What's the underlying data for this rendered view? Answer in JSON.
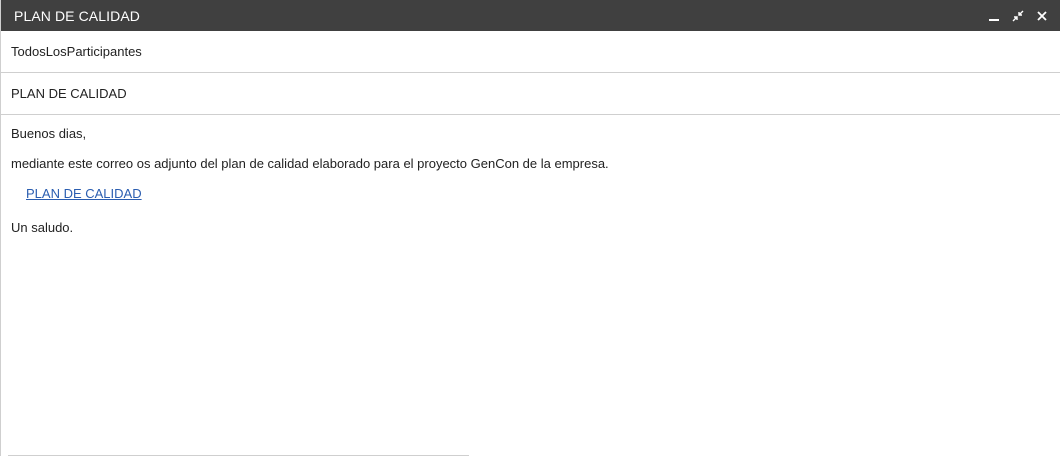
{
  "window": {
    "title": "PLAN DE CALIDAD"
  },
  "controls": {
    "minimize_icon": "minimize-icon",
    "restore_icon": "exit-fullscreen-icon",
    "close_icon": "close-icon"
  },
  "compose": {
    "to": "TodosLosParticipantes",
    "subject": "PLAN DE CALIDAD",
    "greeting": "Buenos dias,",
    "message": "mediante este correo os adjunto del plan de calidad elaborado para el proyecto GenCon de la empresa.",
    "attachment_link": "PLAN DE CALIDAD",
    "closing": "Un saludo."
  },
  "colors": {
    "titlebar": "#404040",
    "link": "#2a5db0",
    "divider": "#cfcfcf"
  }
}
